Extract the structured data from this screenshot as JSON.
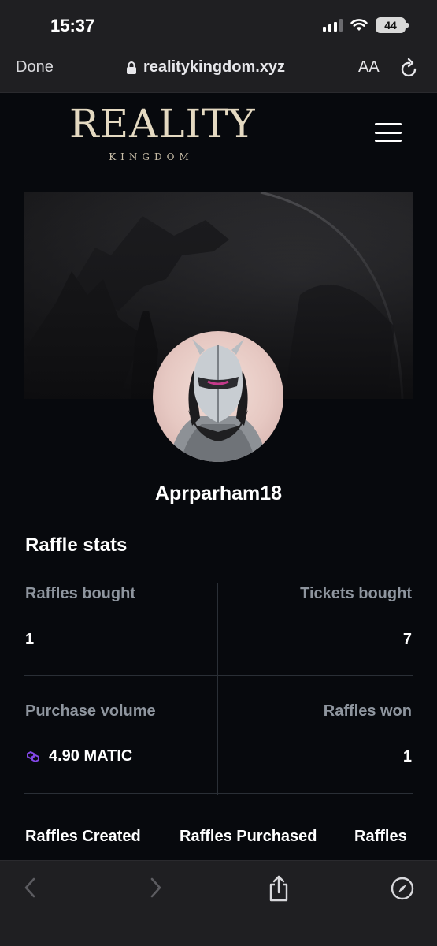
{
  "status_bar": {
    "time": "15:37",
    "battery": "44"
  },
  "browser": {
    "done_label": "Done",
    "url": "realitykingdom.xyz",
    "text_size_label": "AA"
  },
  "site": {
    "logo_main": "REALITY",
    "logo_sub": "KINGDOM"
  },
  "profile": {
    "username": "Aprparham18"
  },
  "raffle_stats": {
    "title": "Raffle stats",
    "raffles_bought_label": "Raffles bought",
    "raffles_bought_value": "1",
    "tickets_bought_label": "Tickets bought",
    "tickets_bought_value": "7",
    "purchase_volume_label": "Purchase volume",
    "purchase_volume_value": "4.90 MATIC",
    "raffles_won_label": "Raffles won",
    "raffles_won_value": "1"
  },
  "tabs": [
    {
      "label": "Raffles Created"
    },
    {
      "label": "Raffles Purchased"
    },
    {
      "label": "Raffles"
    }
  ],
  "colors": {
    "accent_matic": "#8247e5",
    "label_gray": "#8e959e",
    "background": "#07090d"
  }
}
